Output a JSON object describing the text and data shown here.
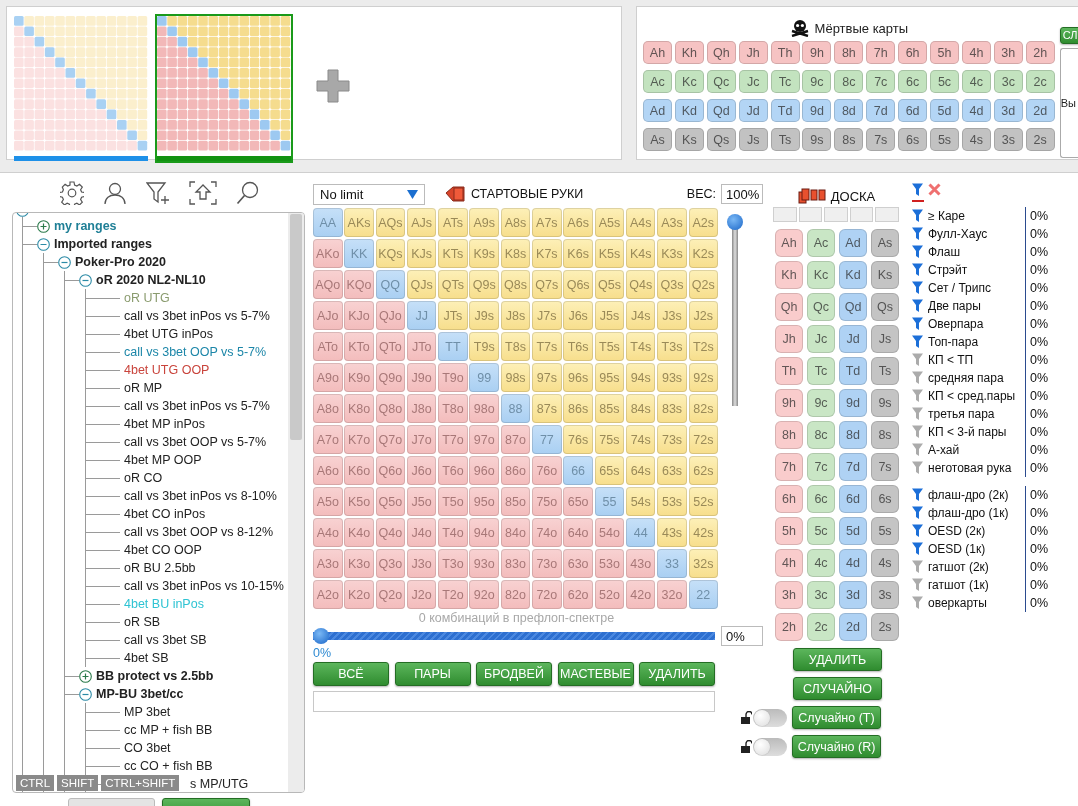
{
  "range_thumbnails": [
    {
      "selected": false
    },
    {
      "selected": true
    }
  ],
  "dead_cards": {
    "title": "Мёртвые карты",
    "rows": [
      {
        "color": "#f6c3c3",
        "cards": [
          "Ah",
          "Kh",
          "Qh",
          "Jh",
          "Th",
          "9h",
          "8h",
          "7h",
          "6h",
          "5h",
          "4h",
          "3h",
          "2h"
        ]
      },
      {
        "color": "#c3e3bf",
        "cards": [
          "Ac",
          "Kc",
          "Qc",
          "Jc",
          "Tc",
          "9c",
          "8c",
          "7c",
          "6c",
          "5c",
          "4c",
          "3c",
          "2c"
        ]
      },
      {
        "color": "#b3d5f5",
        "cards": [
          "Ad",
          "Kd",
          "Qd",
          "Jd",
          "Td",
          "9d",
          "8d",
          "7d",
          "6d",
          "5d",
          "4d",
          "3d",
          "2d"
        ]
      },
      {
        "color": "#c2c2c2",
        "cards": [
          "As",
          "Ks",
          "Qs",
          "Js",
          "Ts",
          "9s",
          "8s",
          "7s",
          "6s",
          "5s",
          "4s",
          "3s",
          "2s"
        ]
      }
    ]
  },
  "side_panel": {
    "button": "СЛ",
    "label": "Вы"
  },
  "tree": {
    "expanded": true,
    "children": [
      {
        "label": "my ranges",
        "expanded": false,
        "color": "#1f7f96"
      },
      {
        "label": "Imported ranges",
        "expanded": true,
        "children": [
          {
            "label": "Poker-Pro 2020",
            "expanded": true,
            "children": [
              {
                "label": "oR 2020 NL2-NL10",
                "expanded": true,
                "children": [
                  {
                    "label": "oR UTG",
                    "color": "#8a9b6e"
                  },
                  {
                    "label": "call vs 3bet inPos vs 5-7%"
                  },
                  {
                    "label": "4bet UTG inPos"
                  },
                  {
                    "label": "call  vs 3bet OOP vs 5-7%",
                    "color": "#1c86a8"
                  },
                  {
                    "label": "4bet UTG OOP",
                    "color": "#c9443c"
                  },
                  {
                    "label": "oR MP"
                  },
                  {
                    "label": "call vs 3bet inPos vs 5-7%"
                  },
                  {
                    "label": "4bet MP inPos"
                  },
                  {
                    "label": "call vs 3bet OOP vs 5-7%"
                  },
                  {
                    "label": "4bet MP OOP"
                  },
                  {
                    "label": "oR CO"
                  },
                  {
                    "label": "call vs 3bet inPos vs 8-10%"
                  },
                  {
                    "label": "4bet CO inPos"
                  },
                  {
                    "label": "call vs 3bet OOP vs 8-12%"
                  },
                  {
                    "label": "4bet CO OOP"
                  },
                  {
                    "label": "oR BU 2.5bb"
                  },
                  {
                    "label": "call vs 3bet inPos vs 10-15%"
                  },
                  {
                    "label": "4bet BU inPos",
                    "color": "#2ec3d3"
                  },
                  {
                    "label": "oR SB"
                  },
                  {
                    "label": "call vs 3bet SB"
                  },
                  {
                    "label": "4bet SB"
                  }
                ]
              },
              {
                "label": "BB protect vs 2.5bb",
                "expanded": false
              },
              {
                "label": "MP-BU 3bet/cc",
                "expanded": true,
                "children": [
                  {
                    "label": "MP 3bet"
                  },
                  {
                    "label": "cc MP + fish BB"
                  },
                  {
                    "label": "CO 3bet"
                  },
                  {
                    "label": "cc CO + fish BB"
                  },
                  {
                    "label": "s MP/UTG"
                  }
                ]
              }
            ]
          }
        ]
      }
    ]
  },
  "modifier_keys": [
    "CTRL",
    "SHIFT",
    "CTRL+SHIFT"
  ],
  "starting_hands": {
    "game": "No limit",
    "title": "СТАРТОВЫЕ РУКИ",
    "weight_label": "ВЕС:",
    "weight": "100%",
    "weight_slider": {
      "level": 1
    },
    "rows": [
      [
        "AA",
        "AKs",
        "AQs",
        "AJs",
        "ATs",
        "A9s",
        "A8s",
        "A7s",
        "A6s",
        "A5s",
        "A4s",
        "A3s",
        "A2s"
      ],
      [
        "AKo",
        "KK",
        "KQs",
        "KJs",
        "KTs",
        "K9s",
        "K8s",
        "K7s",
        "K6s",
        "K5s",
        "K4s",
        "K3s",
        "K2s"
      ],
      [
        "AQo",
        "KQo",
        "QQ",
        "QJs",
        "QTs",
        "Q9s",
        "Q8s",
        "Q7s",
        "Q6s",
        "Q5s",
        "Q4s",
        "Q3s",
        "Q2s"
      ],
      [
        "AJo",
        "KJo",
        "QJo",
        "JJ",
        "JTs",
        "J9s",
        "J8s",
        "J7s",
        "J6s",
        "J5s",
        "J4s",
        "J3s",
        "J2s"
      ],
      [
        "ATo",
        "KTo",
        "QTo",
        "JTo",
        "TT",
        "T9s",
        "T8s",
        "T7s",
        "T6s",
        "T5s",
        "T4s",
        "T3s",
        "T2s"
      ],
      [
        "A9o",
        "K9o",
        "Q9o",
        "J9o",
        "T9o",
        "99",
        "98s",
        "97s",
        "96s",
        "95s",
        "94s",
        "93s",
        "92s"
      ],
      [
        "A8o",
        "K8o",
        "Q8o",
        "J8o",
        "T8o",
        "98o",
        "88",
        "87s",
        "86s",
        "85s",
        "84s",
        "83s",
        "82s"
      ],
      [
        "A7o",
        "K7o",
        "Q7o",
        "J7o",
        "T7o",
        "97o",
        "87o",
        "77",
        "76s",
        "75s",
        "74s",
        "73s",
        "72s"
      ],
      [
        "A6o",
        "K6o",
        "Q6o",
        "J6o",
        "T6o",
        "96o",
        "86o",
        "76o",
        "66",
        "65s",
        "64s",
        "63s",
        "62s"
      ],
      [
        "A5o",
        "K5o",
        "Q5o",
        "J5o",
        "T5o",
        "95o",
        "85o",
        "75o",
        "65o",
        "55",
        "54s",
        "53s",
        "52s"
      ],
      [
        "A4o",
        "K4o",
        "Q4o",
        "J4o",
        "T4o",
        "94o",
        "84o",
        "74o",
        "64o",
        "54o",
        "44",
        "43s",
        "42s"
      ],
      [
        "A3o",
        "K3o",
        "Q3o",
        "J3o",
        "T3o",
        "93o",
        "83o",
        "73o",
        "63o",
        "53o",
        "43o",
        "33",
        "32s"
      ],
      [
        "A2o",
        "K2o",
        "Q2o",
        "J2o",
        "T2o",
        "92o",
        "82o",
        "72o",
        "62o",
        "52o",
        "42o",
        "32o",
        "22"
      ]
    ],
    "combos": "0 комбинаций в префлоп-спектре",
    "range_slider": {
      "level": 0
    },
    "range_value": "0%",
    "range_reading": "0%",
    "buttons": [
      "ВСЁ",
      "ПАРЫ",
      "БРОДВЕЙ",
      "МАСТЕВЫЕ",
      "УДАЛИТЬ"
    ]
  },
  "board": {
    "title": "ДОСКА",
    "columns": [
      {
        "color": "#f9cccc",
        "cards": [
          "Ah",
          "Kh",
          "Qh",
          "Jh",
          "Th",
          "9h",
          "8h",
          "7h",
          "6h",
          "5h",
          "4h",
          "3h",
          "2h"
        ]
      },
      {
        "color": "#c9e6c5",
        "cards": [
          "Ac",
          "Kc",
          "Qc",
          "Jc",
          "Tc",
          "9c",
          "8c",
          "7c",
          "6c",
          "5c",
          "4c",
          "3c",
          "2c"
        ]
      },
      {
        "color": "#afd2f4",
        "cards": [
          "Ad",
          "Kd",
          "Qd",
          "Jd",
          "Td",
          "9d",
          "8d",
          "7d",
          "6d",
          "5d",
          "4d",
          "3d",
          "2d"
        ]
      },
      {
        "color": "#c4c4c4",
        "cards": [
          "As",
          "Ks",
          "Qs",
          "Js",
          "Ts",
          "9s",
          "8s",
          "7s",
          "6s",
          "5s",
          "4s",
          "3s",
          "2s"
        ]
      }
    ],
    "buttons": [
      "УДАЛИТЬ",
      "СЛУЧАЙНО"
    ],
    "random_toggles": [
      {
        "label": "Случайно (T)",
        "locked": false,
        "on": false
      },
      {
        "label": "Случайно (R)",
        "locked": false,
        "on": false
      }
    ]
  },
  "filters": {
    "groups": [
      [
        {
          "label": "≥ Каре",
          "active": true,
          "value": "0%"
        },
        {
          "label": "Фулл-Хаус",
          "active": true,
          "value": "0%"
        },
        {
          "label": "Флаш",
          "active": true,
          "value": "0%"
        },
        {
          "label": "Стрэйт",
          "active": true,
          "value": "0%"
        },
        {
          "label": "Сет / Трипс",
          "active": true,
          "value": "0%"
        },
        {
          "label": "Две пары",
          "active": true,
          "value": "0%"
        },
        {
          "label": "Оверпара",
          "active": true,
          "value": "0%"
        },
        {
          "label": "Топ-пара",
          "active": true,
          "value": "0%"
        },
        {
          "label": "КП < ТП",
          "active": false,
          "value": "0%"
        },
        {
          "label": "средняя пара",
          "active": false,
          "value": "0%"
        },
        {
          "label": "КП < сред.пары",
          "active": false,
          "value": "0%"
        },
        {
          "label": "третья пара",
          "active": false,
          "value": "0%"
        },
        {
          "label": "КП < 3-й пары",
          "active": false,
          "value": "0%"
        },
        {
          "label": "А-хай",
          "active": false,
          "value": "0%"
        },
        {
          "label": "неготовая рука",
          "active": false,
          "value": "0%"
        }
      ],
      [
        {
          "label": "флаш-дро (2к)",
          "active": true,
          "value": "0%"
        },
        {
          "label": "флаш-дро (1к)",
          "active": true,
          "value": "0%"
        },
        {
          "label": "OESD (2к)",
          "active": true,
          "value": "0%"
        },
        {
          "label": "OESD (1к)",
          "active": true,
          "value": "0%"
        },
        {
          "label": "гатшот (2к)",
          "active": false,
          "value": "0%"
        },
        {
          "label": "гатшот (1к)",
          "active": false,
          "value": "0%"
        },
        {
          "label": "оверкарты",
          "active": false,
          "value": "0%"
        }
      ]
    ]
  }
}
